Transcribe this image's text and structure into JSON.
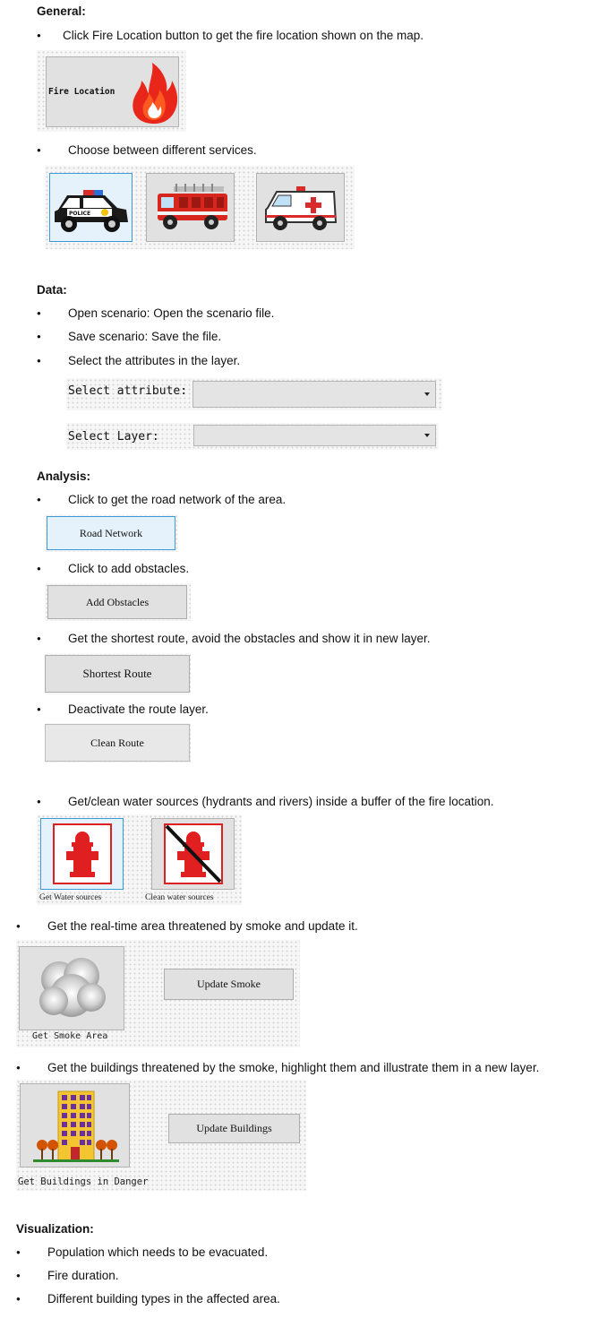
{
  "general": {
    "heading": "General:",
    "bullet1": "Click Fire Location button to get the fire location shown on the map.",
    "fire_button_label": "Fire Location",
    "bullet2": "Choose between different services.",
    "services": [
      "police-car",
      "fire-truck",
      "ambulance"
    ]
  },
  "data": {
    "heading": "Data:",
    "bullets": [
      "Open scenario: Open the scenario file.",
      "Save scenario: Save the file.",
      "Select the attributes in the layer."
    ],
    "select_attribute_label": "Select attribute:",
    "select_layer_label": "Select Layer:",
    "select_attribute_value": "",
    "select_layer_value": ""
  },
  "analysis": {
    "heading": "Analysis:",
    "bullet_road": "Click to get the road network of the area.",
    "road_button": "Road Network",
    "bullet_obstacles": "Click to add obstacles.",
    "obstacles_button": "Add Obstacles",
    "bullet_shortest": "Get the shortest route, avoid the obstacles and show it in new layer.",
    "shortest_button": "Shortest Route",
    "bullet_deactivate": "Deactivate the route layer.",
    "clean_button": "Clean Route",
    "bullet_water": "Get/clean water sources (hydrants and rivers) inside a buffer of the fire location.",
    "get_water_label": "Get Water sources",
    "clean_water_label": "Clean water sources",
    "bullet_smoke": "Get the real-time area threatened by smoke and update it.",
    "get_smoke_label": "Get Smoke Area",
    "update_smoke_button": "Update Smoke",
    "bullet_buildings": "Get the buildings threatened by the smoke, highlight them and illustrate them in a new layer.",
    "get_buildings_label": "Get Buildings in Danger",
    "update_buildings_button": "Update Buildings"
  },
  "visualization": {
    "heading": "Visualization:",
    "bullets": [
      "Population which needs to be evacuated.",
      "Fire duration.",
      "Different building types in the affected area."
    ]
  },
  "bullet_char": "●",
  "colors": {
    "highlight_border": "#3c9ad6",
    "button_bg": "#e1e1e1",
    "fire_red": "#e8261a"
  }
}
